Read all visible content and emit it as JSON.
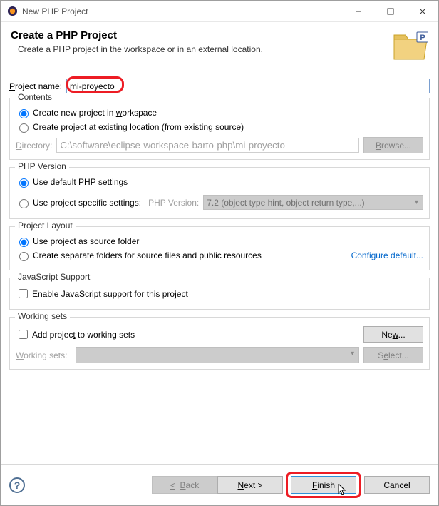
{
  "window": {
    "title": "New PHP Project"
  },
  "header": {
    "title": "Create a PHP Project",
    "subtitle": "Create a PHP project in the workspace or in an external location."
  },
  "projectName": {
    "label_pre": "P",
    "label_post": "roject name:",
    "value": "mi-proyecto"
  },
  "contents": {
    "group": "Contents",
    "opt1_pre": "Create new project in ",
    "opt1_u": "w",
    "opt1_post": "orkspace",
    "opt2_pre": "Create project at e",
    "opt2_u": "x",
    "opt2_post": "isting location (from existing source)",
    "dir_label_pre": "D",
    "dir_label_post": "irectory:",
    "dir_value": "C:\\software\\eclipse-workspace-barto-php\\mi-proyecto",
    "browse_pre": "B",
    "browse_post": "rowse..."
  },
  "phpVersion": {
    "group": "PHP Version",
    "opt1": "Use default PHP settings",
    "opt2": "Use project specific settings:",
    "combo_label": "PHP Version:",
    "combo_value": "7.2 (object type hint, object return type,...)"
  },
  "layout": {
    "group": "Project Layout",
    "opt1": "Use project as source folder",
    "opt2": "Create separate folders for source files and public resources",
    "link": "Configure default..."
  },
  "jsSupport": {
    "group": "JavaScript Support",
    "checkbox": "Enable JavaScript support for this project"
  },
  "workingSets": {
    "group": "Working sets",
    "checkbox_pre": "Add projec",
    "checkbox_u": "t",
    "checkbox_post": " to working sets",
    "new_pre": "Ne",
    "new_u": "w",
    "new_post": "...",
    "label_pre": "W",
    "label_post": "orking sets:",
    "select_pre": "S",
    "select_u": "e",
    "select_post": "lect..."
  },
  "footer": {
    "back": "< Back",
    "next": "Next >",
    "finish": "Finish",
    "cancel": "Cancel"
  }
}
